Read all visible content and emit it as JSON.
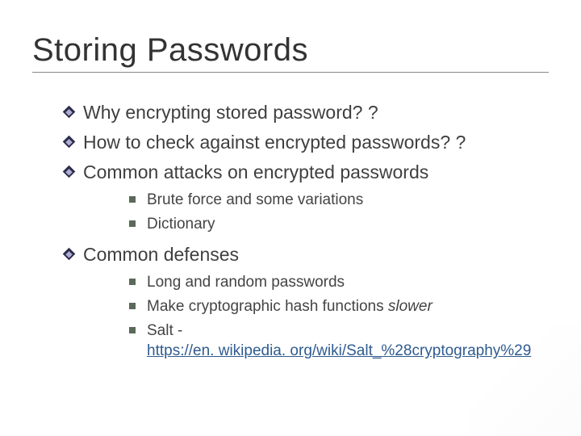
{
  "title": "Storing Passwords",
  "l1": {
    "i0": "Why encrypting stored password? ?",
    "i1": "How to check against encrypted passwords? ?",
    "i2": "Common attacks on encrypted passwords",
    "i3": "Common defenses"
  },
  "l2a": {
    "i0": "Brute force and some variations",
    "i1": "Dictionary"
  },
  "l2b": {
    "i0": "Long and random passwords",
    "i1_pre": "Make cryptographic hash functions ",
    "i1_em": "slower",
    "i2_pre": "Salt - ",
    "i2_link": "https://en. wikipedia. org/wiki/Salt_%28cryptography%29"
  }
}
